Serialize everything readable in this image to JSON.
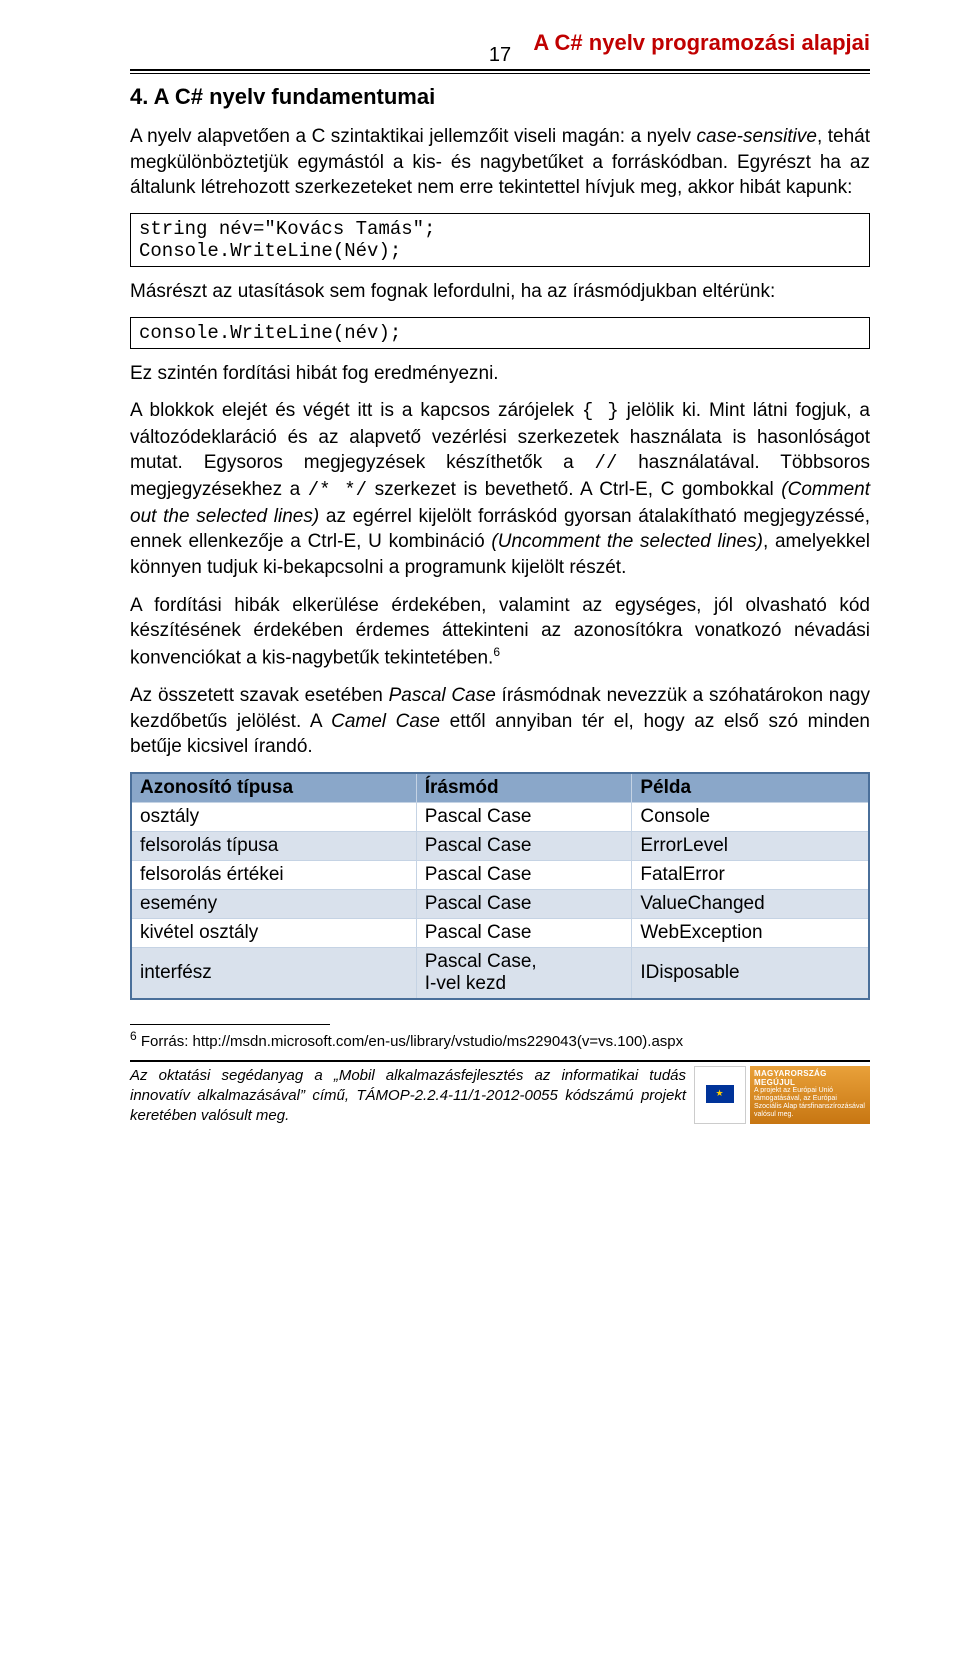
{
  "header": {
    "title": "A C# nyelv programozási alapjai",
    "page_number": "17"
  },
  "section": {
    "title": "4. A C# nyelv fundamentumai"
  },
  "p1_a": "A nyelv alapvetően a C szintaktikai jellemzőit viseli magán: a nyelv ",
  "p1_b": "case-sensitive",
  "p1_c": ", tehát megkülönböztetjük egymástól a kis- és nagybetűket a forráskódban. Egyrészt ha az általunk létrehozott szerkezeteket nem erre tekintettel hívjuk meg, akkor hibát kapunk:",
  "code1": "string név=\"Kovács Tamás\";\nConsole.WriteLine(Név);",
  "p2": "Másrészt az utasítások sem fognak lefordulni, ha az írásmódjukban eltérünk:",
  "code2": "console.WriteLine(név);",
  "p3": "Ez szintén fordítási hibát fog eredményezni.",
  "p4_a": "A blokkok elejét és végét itt is a kapcsos zárójelek ",
  "p4_b": "{ }",
  "p4_c": " jelölik ki. Mint látni fogjuk, a változódeklaráció és az alapvető vezérlési szerkezetek használata is hasonlóságot mutat.",
  "p5_a": "Egysoros megjegyzések készíthetők a ",
  "p5_b": "//",
  "p5_c": " használatával. Többsoros megjegyzésekhez a ",
  "p5_d": "/* */",
  "p5_e": " szerkezet is bevethető. A Ctrl-E, C gombokkal ",
  "p5_f": "(Comment out the selected lines)",
  "p5_g": " az egérrel kijelölt forráskód gyorsan átalakítható megjegyzéssé, ennek ellenkezője a Ctrl-E, U kombináció ",
  "p5_h": "(Uncomment the selected lines)",
  "p5_i": ", amelyekkel könnyen tudjuk ki-bekapcsolni a programunk kijelölt részét.",
  "p6_a": "A fordítási hibák elkerülése érdekében, valamint az egységes, jól olvasható kód készítésének érdekében érdemes áttekinteni az azonosítókra vonatkozó névadási konvenciókat a kis-nagybetűk tekintetében.",
  "p6_sup": "6",
  "p7_a": "Az összetett szavak esetében ",
  "p7_b": "Pascal Case",
  "p7_c": " írásmódnak nevezzük a szóhatárokon nagy kezdőbetűs jelölést. A ",
  "p7_d": "Camel Case",
  "p7_e": " ettől annyiban tér el, hogy az első szó minden betűje kicsivel írandó.",
  "table": {
    "headers": {
      "c1": "Azonosító típusa",
      "c2": "Írásmód",
      "c3": "Példa"
    },
    "rows": [
      {
        "c1": "osztály",
        "c2": "Pascal Case",
        "c3": "Console",
        "alt": false
      },
      {
        "c1": "felsorolás típusa",
        "c2": "Pascal Case",
        "c3": "ErrorLevel",
        "alt": true
      },
      {
        "c1": "felsorolás értékei",
        "c2": "Pascal Case",
        "c3": "FatalError",
        "alt": false
      },
      {
        "c1": "esemény",
        "c2": "Pascal Case",
        "c3": "ValueChanged",
        "alt": true
      },
      {
        "c1": "kivétel osztály",
        "c2": "Pascal Case",
        "c3": "WebException",
        "alt": false
      },
      {
        "c1": "interfész",
        "c2": "Pascal Case,\nI-vel kezd",
        "c3": "IDisposable",
        "alt": true
      }
    ]
  },
  "footnote": {
    "mark": "6",
    "text": " Forrás: http://msdn.microsoft.com/en-us/library/vstudio/ms229043(v=vs.100).aspx"
  },
  "footer": {
    "text_a": "Az oktatási segédanyag a ",
    "text_b": "„Mobil alkalmazásfejlesztés az informatikai tudás innovatív alkalmazásával”",
    "text_c": " című, TÁMOP-2.2.4-11/1-2012-0055 kódszámú projekt keretében valósult meg.",
    "logo_title": "MAGYARORSZÁG MEGÚJUL",
    "logo_sub": "A projekt az Európai Unió támogatásával, az Európai Szociális Alap társfinanszírozásával valósul meg."
  }
}
